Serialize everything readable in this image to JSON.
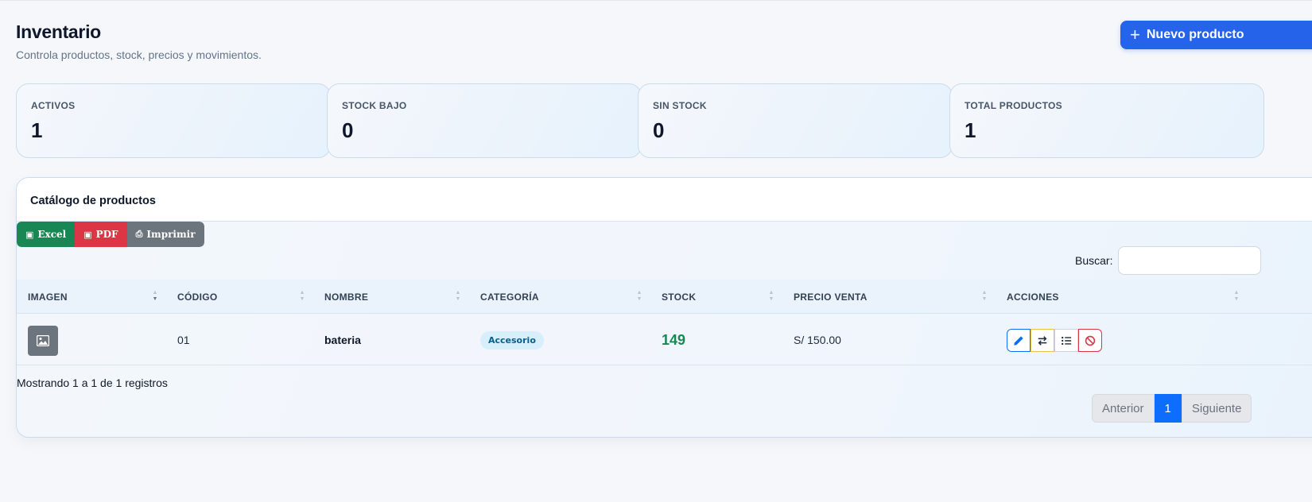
{
  "header": {
    "title": "Inventario",
    "subtitle": "Controla productos, stock, precios y movimientos.",
    "new_button": "Nuevo producto",
    "new_button_icon": "plus-icon"
  },
  "stats": [
    {
      "label": "ACTIVOS",
      "value": "1"
    },
    {
      "label": "STOCK BAJO",
      "value": "0"
    },
    {
      "label": "SIN STOCK",
      "value": "0"
    },
    {
      "label": "TOTAL PRODUCTOS",
      "value": "1"
    }
  ],
  "catalog": {
    "title": "Catálogo de productos",
    "export": {
      "excel": "Excel",
      "pdf": "PDF",
      "print": "Imprimir"
    },
    "search": {
      "label": "Buscar:",
      "value": "",
      "placeholder": ""
    },
    "columns": [
      "IMAGEN",
      "CÓDIGO",
      "NOMBRE",
      "CATEGORÍA",
      "STOCK",
      "PRECIO VENTA",
      "ACCIONES"
    ],
    "rows": [
      {
        "image_icon": "image-icon",
        "code": "01",
        "name": "bateria",
        "category": "Accesorio",
        "stock": "149",
        "price": "S/ 150.00",
        "actions": [
          "pencil-icon",
          "swap-icon",
          "list-icon",
          "ban-icon"
        ]
      }
    ],
    "info": "Mostrando 1 a 1 de 1 registros",
    "pagination": {
      "prev": "Anterior",
      "current": "1",
      "next": "Siguiente"
    }
  },
  "colors": {
    "primary": "#2563eb",
    "excel": "#198754",
    "pdf": "#dc3545",
    "print": "#6c757d",
    "stock_ok": "#198754",
    "page_active": "#0d6efd"
  }
}
